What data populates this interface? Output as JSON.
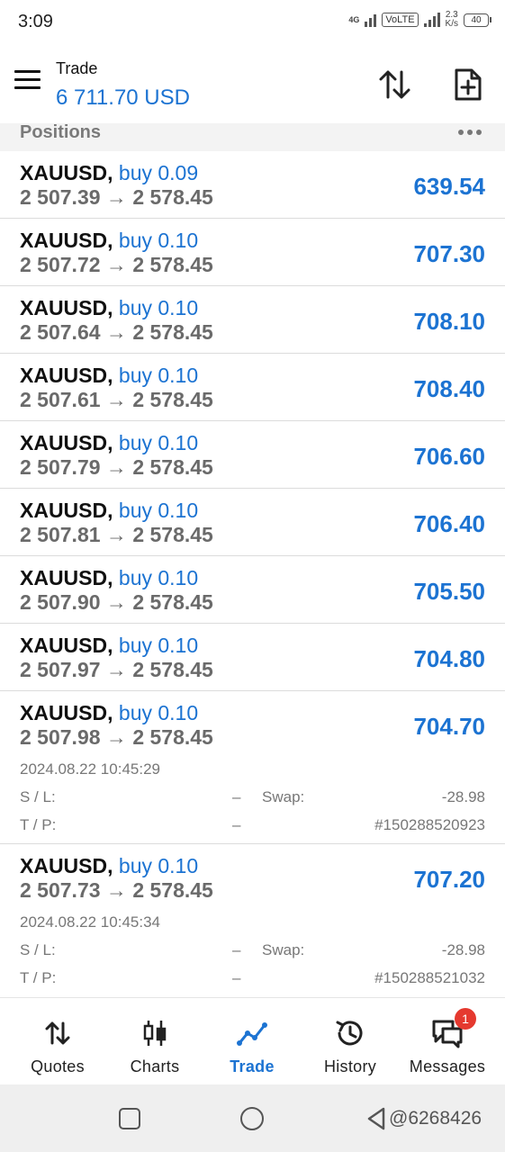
{
  "status": {
    "time": "3:09",
    "network": "4G",
    "volte": "VoLTE",
    "speed_value": "2.3",
    "speed_unit": "K/s",
    "battery": "40"
  },
  "header": {
    "title": "Trade",
    "balance": "6 711.70 USD",
    "icons": [
      "menu-icon",
      "sort-icon",
      "new-order-icon"
    ]
  },
  "section": {
    "title": "Positions",
    "more_icon": "more-dots-icon"
  },
  "positions": [
    {
      "symbol": "XAUUSD,",
      "side": "buy 0.09",
      "open": "2 507.39",
      "arrow": "→",
      "current": "2 578.45",
      "profit": "639.54"
    },
    {
      "symbol": "XAUUSD,",
      "side": "buy 0.10",
      "open": "2 507.72",
      "arrow": "→",
      "current": "2 578.45",
      "profit": "707.30"
    },
    {
      "symbol": "XAUUSD,",
      "side": "buy 0.10",
      "open": "2 507.64",
      "arrow": "→",
      "current": "2 578.45",
      "profit": "708.10"
    },
    {
      "symbol": "XAUUSD,",
      "side": "buy 0.10",
      "open": "2 507.61",
      "arrow": "→",
      "current": "2 578.45",
      "profit": "708.40"
    },
    {
      "symbol": "XAUUSD,",
      "side": "buy 0.10",
      "open": "2 507.79",
      "arrow": "→",
      "current": "2 578.45",
      "profit": "706.60"
    },
    {
      "symbol": "XAUUSD,",
      "side": "buy 0.10",
      "open": "2 507.81",
      "arrow": "→",
      "current": "2 578.45",
      "profit": "706.40"
    },
    {
      "symbol": "XAUUSD,",
      "side": "buy 0.10",
      "open": "2 507.90",
      "arrow": "→",
      "current": "2 578.45",
      "profit": "705.50"
    },
    {
      "symbol": "XAUUSD,",
      "side": "buy 0.10",
      "open": "2 507.97",
      "arrow": "→",
      "current": "2 578.45",
      "profit": "704.80"
    },
    {
      "symbol": "XAUUSD,",
      "side": "buy 0.10",
      "open": "2 507.98",
      "arrow": "→",
      "current": "2 578.45",
      "profit": "704.70",
      "date": "2024.08.22 10:45:29",
      "sl_label": "S / L:",
      "sl": "–",
      "swap_label": "Swap:",
      "swap": "-28.98",
      "tp_label": "T / P:",
      "tp": "–",
      "ticket": "#150288520923"
    },
    {
      "symbol": "XAUUSD,",
      "side": "buy 0.10",
      "open": "2 507.73",
      "arrow": "→",
      "current": "2 578.45",
      "profit": "707.20",
      "date": "2024.08.22 10:45:34",
      "sl_label": "S / L:",
      "sl": "–",
      "swap_label": "Swap:",
      "swap": "-28.98",
      "tp_label": "T / P:",
      "tp": "–",
      "ticket": "#150288521032"
    }
  ],
  "nav": {
    "tabs": [
      {
        "label": "Quotes",
        "icon": "quotes-icon"
      },
      {
        "label": "Charts",
        "icon": "charts-icon"
      },
      {
        "label": "Trade",
        "icon": "trade-icon",
        "active": true
      },
      {
        "label": "History",
        "icon": "history-icon"
      },
      {
        "label": "Messages",
        "icon": "messages-icon",
        "badge": "1"
      }
    ]
  },
  "system_nav": {
    "watermark": "@6268426"
  },
  "colors": {
    "accent": "#1c73d2",
    "badge": "#e5392f"
  }
}
